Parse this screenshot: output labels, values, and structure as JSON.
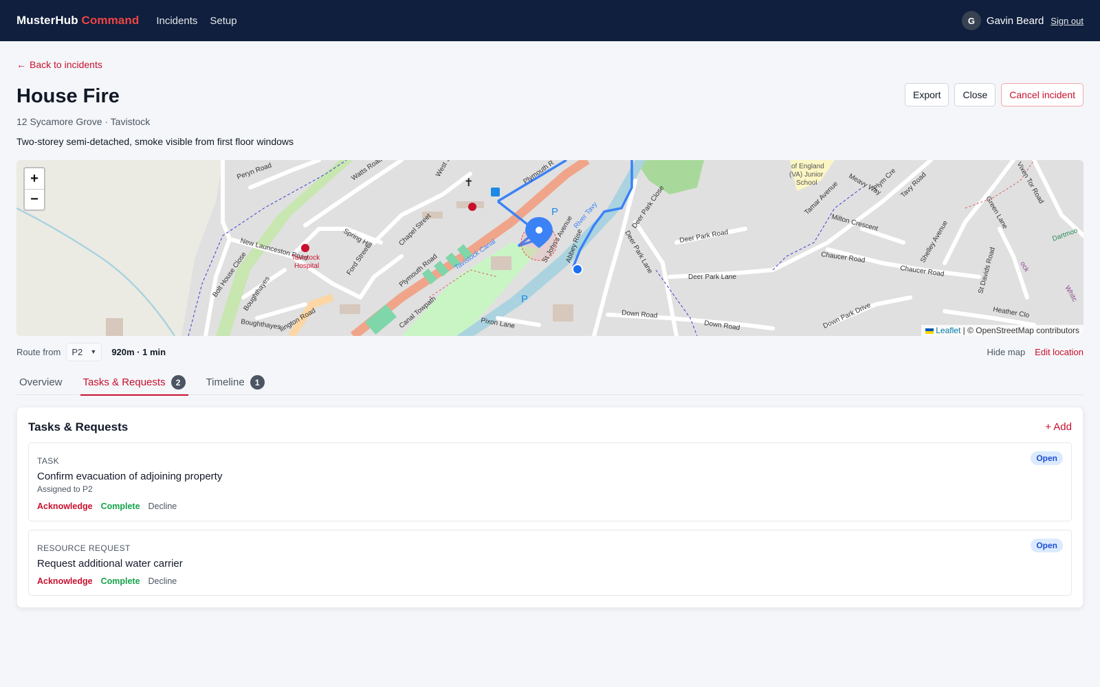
{
  "header": {
    "brand_main": "MusterHub",
    "brand_accent": "Command",
    "nav": [
      "Incidents",
      "Setup"
    ],
    "user_initial": "G",
    "user_name": "Gavin Beard",
    "signout": "Sign out"
  },
  "incident": {
    "back_label": "Back to incidents",
    "title": "House Fire",
    "address": "12 Sycamore Grove · Tavistock",
    "description": "Two-storey semi-detached, smoke visible from first floor windows",
    "actions": {
      "export": "Export",
      "close": "Close",
      "cancel": "Cancel incident"
    }
  },
  "map": {
    "zoom_in": "+",
    "zoom_out": "−",
    "attribution_leaflet": "Leaflet",
    "attribution_rest": " | © OpenStreetMap contributors",
    "labels": {
      "peryn_road": "Peryn Road",
      "watts_road": "Watts Road",
      "west_st": "West St",
      "plymouth_rd_top": "Plymouth R",
      "spring_hill": "Spring Hill",
      "chapel_street": "Chapel Street",
      "new_launceston_road": "New Launceston Road",
      "tavistock_hospital_1": "Tavistock",
      "tavistock_hospital_2": "Hospital",
      "ford_street": "Ford Street",
      "plymouth_road": "Plymouth Road",
      "tavistock_canal": "Tavistock Canal",
      "river_tavy": "River Tavy",
      "st_johns_avenue": "St John's Avenue",
      "bolt_house_close": "Bolt House Close",
      "boughthayes": "Boughthayes",
      "boughthayes_2": "Boughthayes",
      "callington_road": "llington Road",
      "canal_towpath": "Canal Towpath",
      "pixon_lane": "Pixon Lane",
      "abbey_rise": "Abbey Rise",
      "deer_park_close": "Deer Park Close",
      "deer_park_road": "Deer Park Road",
      "deer_park_lane_v": "Deer Park Lane",
      "deer_park_lane": "Deer Park Lane",
      "down_road_1": "Down Road",
      "down_road_2": "Down Road",
      "school_1": "of England",
      "school_2": "(VA) Junior",
      "school_3": "School",
      "tamar_avenue": "Tamar Avenue",
      "meavy_way": "Meavy Way",
      "plym_cres": "Plym Cre",
      "tavy_road": "Tavy Road",
      "milton_crescent": "Milton Crescent",
      "chaucer_road_1": "Chaucer Road",
      "chaucer_road_2": "Chaucer Road",
      "shelley_avenue": "Shelley Avenue",
      "st_davids_road": "St Davids Road",
      "green_lane": "Green Lane",
      "vixen_tor_road": "Vixen Tor Road",
      "dartmoor": "Dartmoo",
      "heather_close": "Heather Clo",
      "down_park_drive": "Down Park Drive",
      "whit": "Whitc",
      "rock": "ock",
      "parking": "P",
      "church": "✝"
    }
  },
  "route": {
    "label": "Route from",
    "from_value": "P2",
    "info": "920m · 1 min",
    "hide_map": "Hide map",
    "edit_location": "Edit location"
  },
  "tabs": [
    {
      "label": "Overview",
      "count": null
    },
    {
      "label": "Tasks & Requests",
      "count": "2"
    },
    {
      "label": "Timeline",
      "count": "1"
    }
  ],
  "panel": {
    "title": "Tasks & Requests",
    "add_label": "+ Add",
    "items": [
      {
        "type": "TASK",
        "title": "Confirm evacuation of adjoining property",
        "assigned": "Assigned to P2",
        "status": "Open",
        "actions": {
          "acknowledge": "Acknowledge",
          "complete": "Complete",
          "decline": "Decline"
        }
      },
      {
        "type": "RESOURCE REQUEST",
        "title": "Request additional water carrier",
        "status": "Open",
        "actions": {
          "acknowledge": "Acknowledge",
          "complete": "Complete",
          "decline": "Decline"
        }
      }
    ]
  },
  "colors": {
    "navy": "#0f1f3d",
    "brand_red": "#c8102e",
    "accent": "#ef4444",
    "green": "#16a34a",
    "route_blue": "#3b82f6"
  }
}
